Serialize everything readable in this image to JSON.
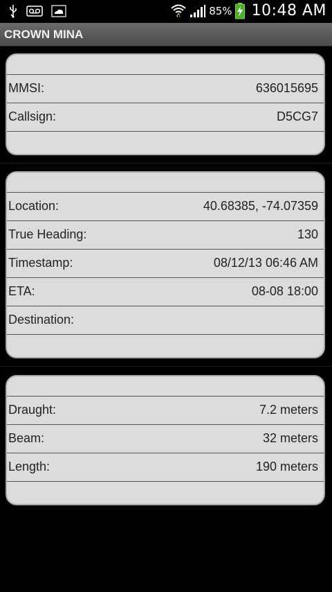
{
  "status_bar": {
    "icons_left": [
      "usb-icon",
      "voicemail-icon",
      "weather-icon"
    ],
    "icons_right": [
      "wifi-icon",
      "signal-icon",
      "battery-charging-icon"
    ],
    "battery_percent": "85%",
    "time": "10:48 AM"
  },
  "app": {
    "title": "CROWN MINA"
  },
  "sections": {
    "identity": {
      "rows": [
        {
          "label": "MMSI:",
          "value": "636015695"
        },
        {
          "label": "Callsign:",
          "value": "D5CG7"
        }
      ]
    },
    "voyage": {
      "rows": [
        {
          "label": "Location:",
          "value": "40.68385, -74.07359"
        },
        {
          "label": "True Heading:",
          "value": "130"
        },
        {
          "label": "Timestamp:",
          "value": "08/12/13 06:46 AM"
        },
        {
          "label": "ETA:",
          "value": "08-08 18:00"
        },
        {
          "label": "Destination:",
          "value": ""
        }
      ]
    },
    "dimensions": {
      "rows": [
        {
          "label": "Draught:",
          "value": "7.2 meters"
        },
        {
          "label": "Beam:",
          "value": "32 meters"
        },
        {
          "label": "Length:",
          "value": "190 meters"
        }
      ]
    }
  },
  "colors": {
    "card_bg": "#dcdcdc",
    "title_bar": "#5a5a5a",
    "background": "#000000"
  }
}
